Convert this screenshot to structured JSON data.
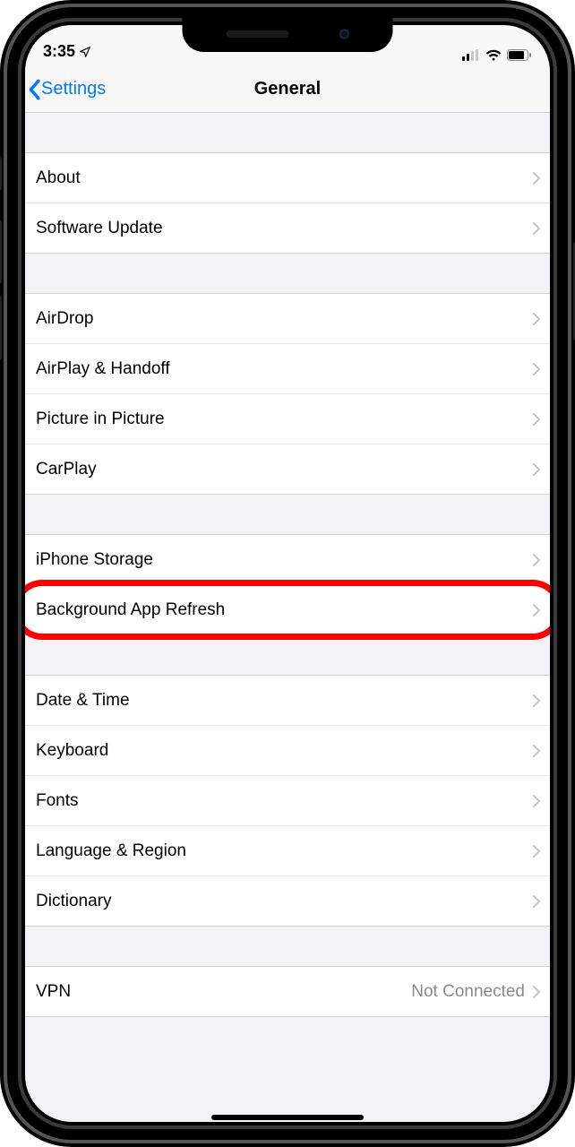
{
  "status": {
    "time": "3:35",
    "location_icon": "location-arrow"
  },
  "nav": {
    "back_label": "Settings",
    "title": "General"
  },
  "groups": [
    {
      "items": [
        {
          "label": "About"
        },
        {
          "label": "Software Update"
        }
      ]
    },
    {
      "items": [
        {
          "label": "AirDrop"
        },
        {
          "label": "AirPlay & Handoff"
        },
        {
          "label": "Picture in Picture"
        },
        {
          "label": "CarPlay"
        }
      ]
    },
    {
      "items": [
        {
          "label": "iPhone Storage"
        },
        {
          "label": "Background App Refresh",
          "highlight": true
        }
      ]
    },
    {
      "items": [
        {
          "label": "Date & Time"
        },
        {
          "label": "Keyboard"
        },
        {
          "label": "Fonts"
        },
        {
          "label": "Language & Region"
        },
        {
          "label": "Dictionary"
        }
      ]
    },
    {
      "items": [
        {
          "label": "VPN",
          "value": "Not Connected"
        }
      ]
    }
  ]
}
